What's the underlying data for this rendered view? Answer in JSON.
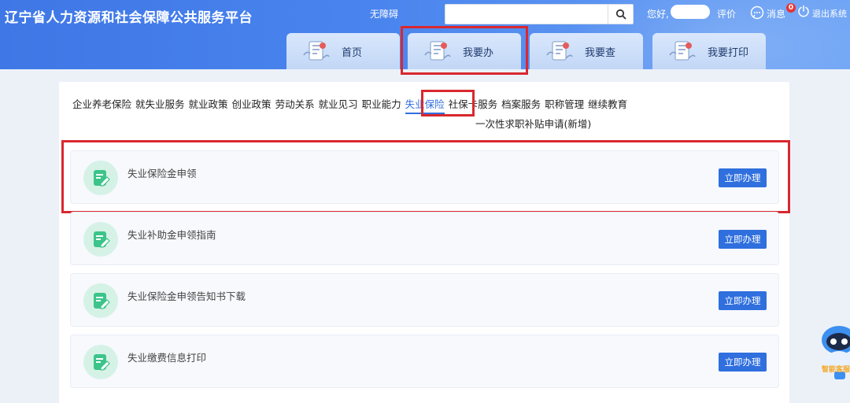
{
  "header": {
    "site_title": "辽宁省人力资源和社会保障公共服务平台",
    "accessibility": "无障碍",
    "search": {
      "placeholder": "",
      "value": ""
    },
    "greeting": "您好,",
    "rate": "评价",
    "messages": {
      "label": "消息",
      "count": "0"
    },
    "logout": "退出系统"
  },
  "nav_tabs": [
    {
      "label": "首页"
    },
    {
      "label": "我要办"
    },
    {
      "label": "我要查"
    },
    {
      "label": "我要打印"
    }
  ],
  "categories": [
    "企业养老保险",
    "就失业服务",
    "就业政策",
    "创业政策",
    "劳动关系",
    "就业见习",
    "职业能力",
    "失业保险",
    "社保卡服务",
    "档案服务",
    "职称管理",
    "继续教育"
  ],
  "category_row2": "一次性求职补贴申请(新增)",
  "active_category": "失业保险",
  "services": [
    {
      "name": "失业保险金申领",
      "button": "立即办理"
    },
    {
      "name": "失业补助金申领指南",
      "button": "立即办理"
    },
    {
      "name": "失业保险金申领告知书下载",
      "button": "立即办理"
    },
    {
      "name": "失业缴费信息打印",
      "button": "立即办理"
    }
  ],
  "assistant": {
    "label": "智能客服"
  },
  "colors": {
    "primary": "#2f6fde",
    "highlight": "#d9282f",
    "header_start": "#3f77e6",
    "icon_green": "#3cc48a"
  }
}
